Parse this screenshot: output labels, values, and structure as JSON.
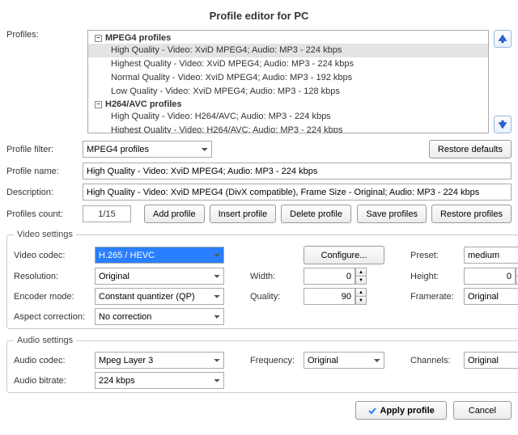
{
  "title": "Profile editor for PC",
  "labels": {
    "profiles": "Profiles:",
    "filter": "Profile filter:",
    "name": "Profile name:",
    "description": "Description:",
    "count": "Profiles count:",
    "video_settings": "Video settings",
    "audio_settings": "Audio settings",
    "video_codec": "Video codec:",
    "resolution": "Resolution:",
    "encoder_mode": "Encoder mode:",
    "aspect": "Aspect correction:",
    "configure": "Configure...",
    "width": "Width:",
    "quality": "Quality:",
    "preset": "Preset:",
    "height": "Height:",
    "framerate": "Framerate:",
    "audio_codec": "Audio codec:",
    "audio_bitrate": "Audio bitrate:",
    "frequency": "Frequency:",
    "channels": "Channels:"
  },
  "buttons": {
    "restore_defaults": "Restore defaults",
    "add": "Add profile",
    "insert": "Insert profile",
    "delete": "Delete profile",
    "save": "Save profiles",
    "restore": "Restore profiles",
    "apply": "Apply profile",
    "cancel": "Cancel"
  },
  "tree": {
    "group1": "MPEG4 profiles",
    "g1_items": [
      "High Quality - Video: XviD MPEG4; Audio: MP3 - 224 kbps",
      "Highest Quality - Video: XviD MPEG4; Audio: MP3 - 224 kbps",
      "Normal Quality - Video: XviD MPEG4; Audio: MP3 - 192 kbps",
      "Low Quality - Video: XviD MPEG4; Audio: MP3 - 128 kbps"
    ],
    "group2": "H264/AVC profiles",
    "g2_items": [
      "High Quality - Video: H264/AVC; Audio: MP3 - 224 kbps",
      "Highest Quality - Video: H264/AVC; Audio: MP3 - 224 kbps"
    ]
  },
  "fields": {
    "filter": "MPEG4 profiles",
    "name": "High Quality - Video: XviD MPEG4; Audio: MP3 - 224 kbps",
    "description": "High Quality - Video: XviD MPEG4 (DivX compatible), Frame Size - Original; Audio: MP3 - 224 kbps",
    "count": "1/15",
    "video_codec": "H.265 / HEVC",
    "resolution": "Original",
    "encoder_mode": "Constant quantizer (QP)",
    "aspect": "No correction",
    "width": "0",
    "quality": "90",
    "preset": "medium",
    "height": "0",
    "framerate": "Original",
    "audio_codec": "Mpeg Layer 3",
    "audio_bitrate": "224 kbps",
    "frequency": "Original",
    "channels": "Original"
  }
}
